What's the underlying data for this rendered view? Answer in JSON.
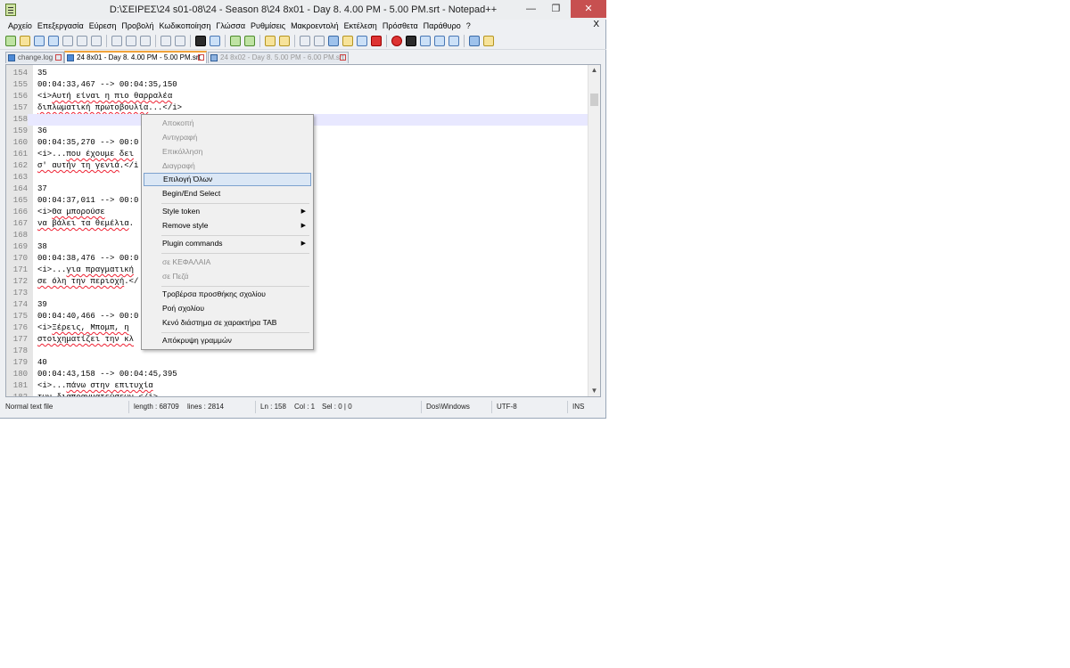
{
  "window": {
    "title": "D:\\ΣΕΙΡΕΣ\\24 s01-08\\24 - Season 8\\24 8x01 - Day 8. 4.00 PM - 5.00 PM.srt - Notepad++",
    "min_glyph": "—",
    "max_glyph": "❐",
    "close_glyph": "✕"
  },
  "menubar": {
    "items": [
      "Αρχείο",
      "Επεξεργασία",
      "Εύρεση",
      "Προβολή",
      "Κωδικοποίηση",
      "Γλώσσα",
      "Ρυθμίσεις",
      "Μακροεντολή",
      "Εκτέλεση",
      "Πρόσθετα",
      "Παράθυρο",
      "?"
    ],
    "close_glyph": "X"
  },
  "tabs": [
    {
      "label": "change.log",
      "state": "inactive"
    },
    {
      "label": "24 8x01 - Day 8. 4.00 PM - 5.00 PM.srt",
      "state": "active"
    },
    {
      "label": "24 8x02 - Day 8. 5.00 PM - 6.00 PM.srt",
      "state": "inactive-grey"
    }
  ],
  "editor": {
    "current_line": 158,
    "lines": [
      {
        "n": "154",
        "text": "35"
      },
      {
        "n": "155",
        "text": "00:04:33,467 --> 00:04:35,150"
      },
      {
        "n": "156",
        "pre": "<i>",
        "greek": "Αυτή είναι η πιο θαρραλέα",
        "post": ""
      },
      {
        "n": "157",
        "pre": "",
        "greek": "διπλωματική πρωτοβουλία",
        "post": "...</i>"
      },
      {
        "n": "158",
        "text": ""
      },
      {
        "n": "159",
        "text": "36"
      },
      {
        "n": "160",
        "text": "00:04:35,270 --> 00:0"
      },
      {
        "n": "161",
        "pre": "<i>...",
        "greek": "που έχουμε δει",
        "post": ""
      },
      {
        "n": "162",
        "pre": "",
        "greek": "σ' αυτήν τη γενιά",
        "post": ".</i"
      },
      {
        "n": "163",
        "text": ""
      },
      {
        "n": "164",
        "text": "37"
      },
      {
        "n": "165",
        "text": "00:04:37,011 --> 00:0"
      },
      {
        "n": "166",
        "pre": "<i>",
        "greek": "Θα μπορούσε",
        "post": ""
      },
      {
        "n": "167",
        "pre": "",
        "greek": "να βάλει τα θεμέλια",
        "post": "."
      },
      {
        "n": "168",
        "text": ""
      },
      {
        "n": "169",
        "text": "38"
      },
      {
        "n": "170",
        "text": "00:04:38,476 --> 00:0"
      },
      {
        "n": "171",
        "pre": "<i>...",
        "greek": "για πραγματική",
        "post": ""
      },
      {
        "n": "172",
        "pre": "",
        "greek": "σε όλη την περιοχή",
        "post": ".</"
      },
      {
        "n": "173",
        "text": ""
      },
      {
        "n": "174",
        "text": "39"
      },
      {
        "n": "175",
        "text": "00:04:40,466 --> 00:0"
      },
      {
        "n": "176",
        "pre": "<i>",
        "greek": "Ξέρεις, Μπομπ, η",
        "post": ""
      },
      {
        "n": "177",
        "pre": "",
        "greek": "στοιχηματίζει την κλ",
        "post": ""
      },
      {
        "n": "178",
        "text": ""
      },
      {
        "n": "179",
        "text": "40"
      },
      {
        "n": "180",
        "text": "00:04:43,158 --> 00:04:45,395"
      },
      {
        "n": "181",
        "pre": "<i>...",
        "greek": "πάνω στην επιτυχία",
        "post": ""
      },
      {
        "n": "182",
        "pre": "",
        "greek": "των διαπραγματεύσεων",
        "post": ".</i>"
      }
    ]
  },
  "statusbar": {
    "filetype": "Normal text file",
    "length": "length : 68709",
    "lines": "lines : 2814",
    "ln": "Ln : 158",
    "col": "Col : 1",
    "sel": "Sel : 0 | 0",
    "eol": "Dos\\Windows",
    "encoding": "UTF-8",
    "mode": "INS"
  },
  "context_menu": {
    "items": [
      {
        "label": "Αποκοπή",
        "state": "disabled"
      },
      {
        "label": "Αντιγραφή",
        "state": "disabled"
      },
      {
        "label": "Επικόλληση",
        "state": "disabled"
      },
      {
        "label": "Διαγραφή",
        "state": "disabled"
      },
      {
        "label": "Επιλογή Όλων",
        "state": "hover"
      },
      {
        "label": "Begin/End Select",
        "state": "enabled"
      },
      {
        "label": "Style token",
        "state": "enabled",
        "submenu": true
      },
      {
        "label": "Remove style",
        "state": "enabled",
        "submenu": true
      },
      {
        "label": "Plugin commands",
        "state": "enabled",
        "submenu": true
      },
      {
        "label": "σε ΚΕΦΑΛΑΙΑ",
        "state": "disabled"
      },
      {
        "label": "σε Πεζά",
        "state": "disabled"
      },
      {
        "label": "Τροβέρσα προσθήκης σχολίου",
        "state": "enabled"
      },
      {
        "label": "Ροή σχολίου",
        "state": "enabled"
      },
      {
        "label": "Κενό διάστημα σε χαρακτήρα TAB",
        "state": "enabled"
      },
      {
        "label": "Απόκρυψη γραμμών",
        "state": "enabled"
      }
    ],
    "submenu_glyph": "▶"
  },
  "scrollbar": {
    "up_glyph": "▲",
    "down_glyph": "▼"
  }
}
